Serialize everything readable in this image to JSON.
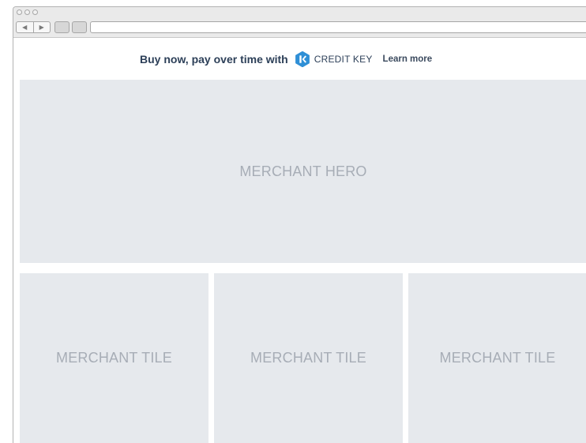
{
  "browser": {
    "nav_back_glyph": "◀",
    "nav_forward_glyph": "▶"
  },
  "promo": {
    "text": "Buy now, pay over time with",
    "brand": "CREDIT KEY",
    "learn_more": "Learn more",
    "logo_icon": "credit-key-logo-icon",
    "brand_color": "#2f8fd6"
  },
  "hero": {
    "label": "MERCHANT HERO"
  },
  "tiles": [
    {
      "label": "MERCHANT TILE"
    },
    {
      "label": "MERCHANT TILE"
    },
    {
      "label": "MERCHANT TILE"
    }
  ],
  "colors": {
    "placeholder_bg": "#e6e9ed",
    "placeholder_text": "#a7adb6",
    "promo_text": "#2c3f58"
  }
}
